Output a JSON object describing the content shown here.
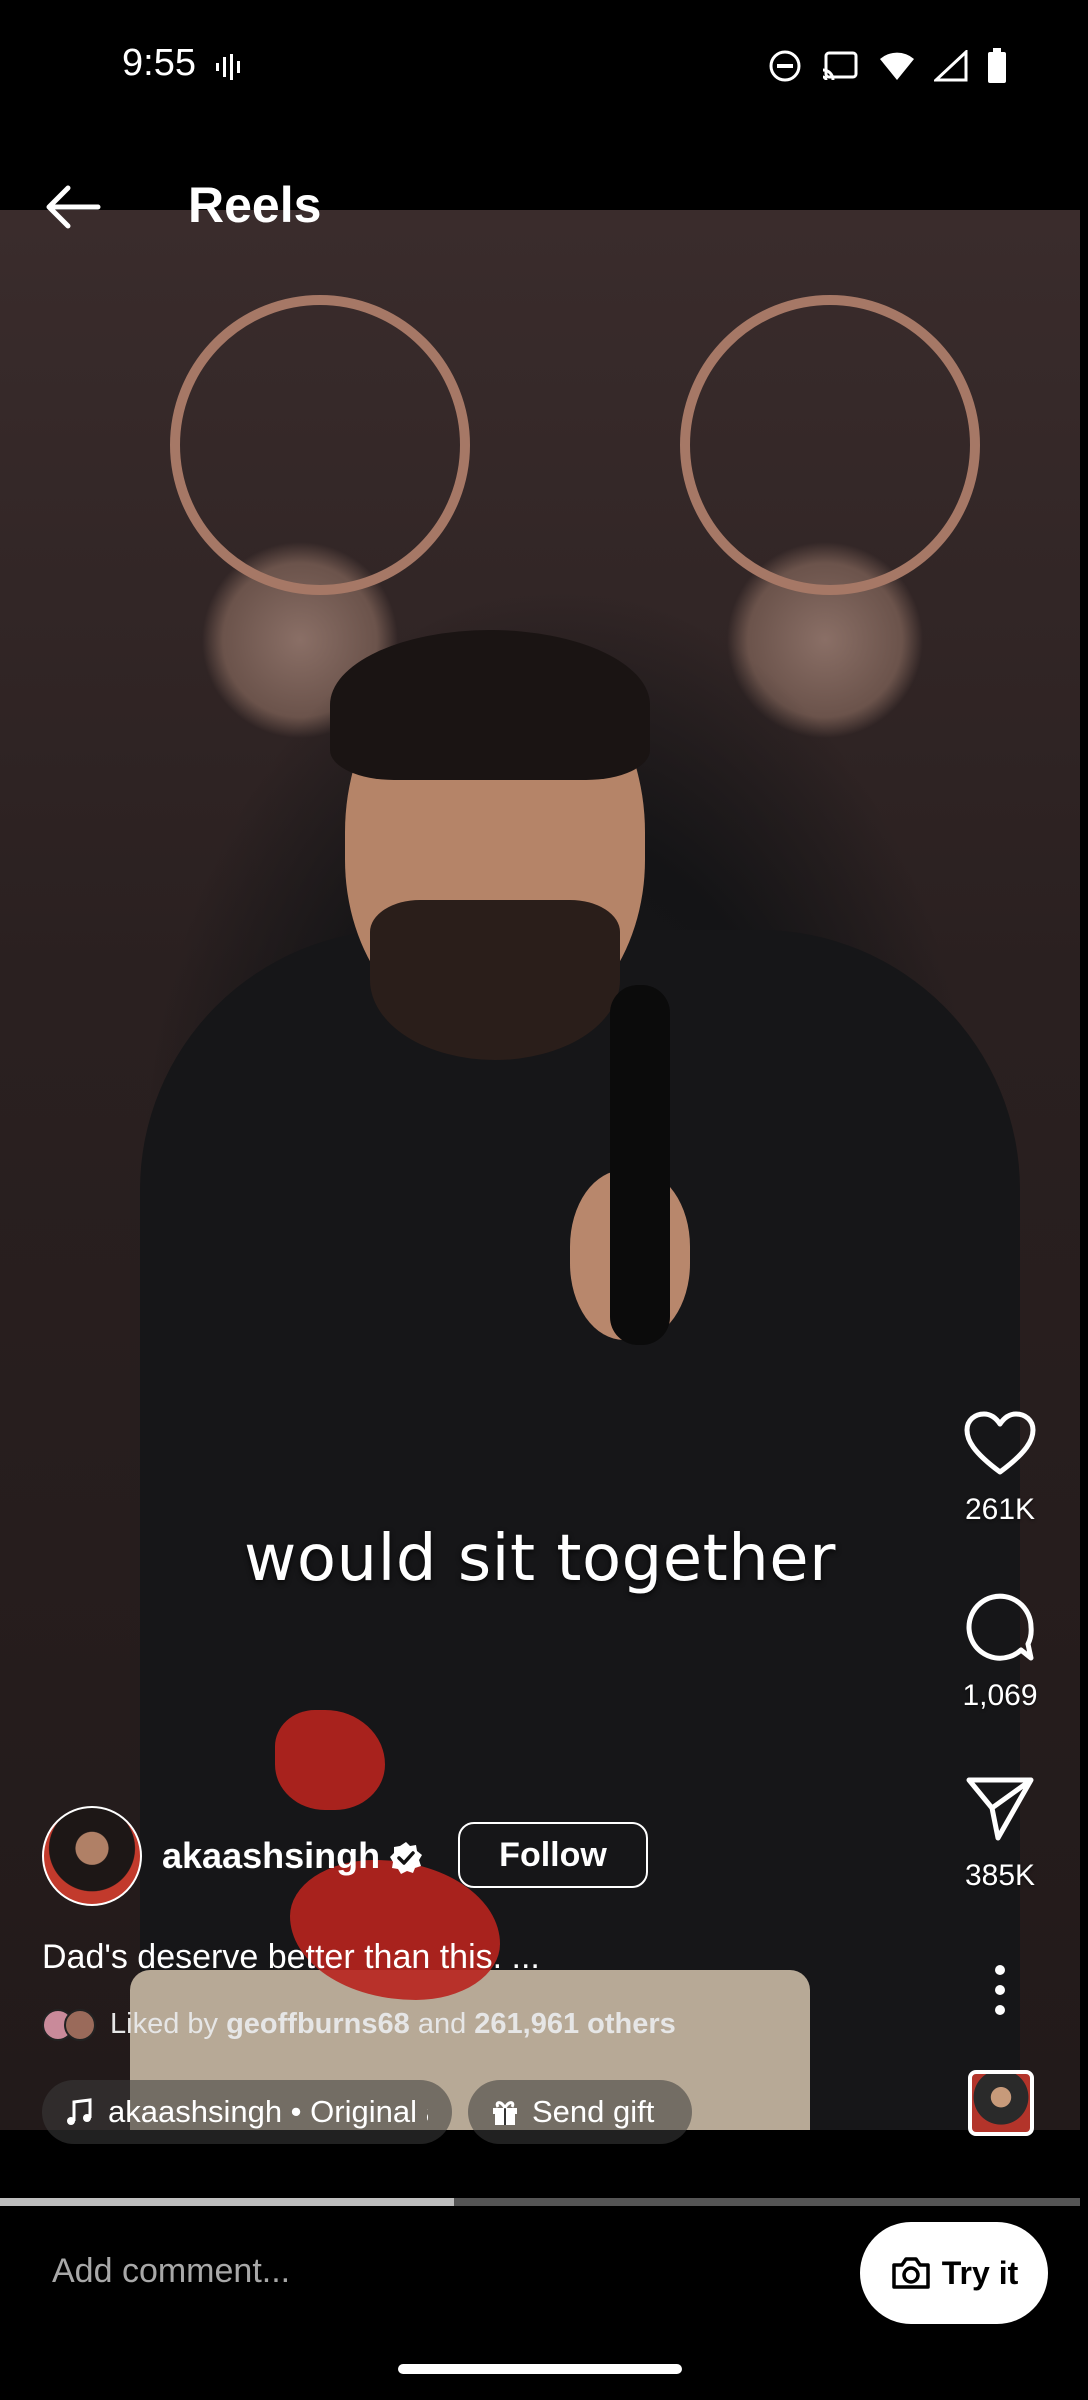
{
  "status_bar": {
    "time": "9:55"
  },
  "header": {
    "title": "Reels"
  },
  "video": {
    "caption": "would sit together"
  },
  "actions": {
    "likes": "261K",
    "comments": "1,069",
    "shares": "385K"
  },
  "author": {
    "username": "akaashsingh",
    "follow_label": "Follow"
  },
  "post": {
    "description": "Dad's deserve better than this. ...",
    "liked_by_prefix": "Liked by ",
    "liked_by_user": "geoffburns68",
    "liked_by_and": " and ",
    "liked_by_others": "261,961 others"
  },
  "chips": {
    "audio": "akaashsingh • Original audio",
    "gift": "Send gift"
  },
  "playback": {
    "progress": 0.42
  },
  "comment_bar": {
    "placeholder": "Add comment...",
    "try_it_label": "Try it"
  },
  "colors": {
    "accent": "#ffffff",
    "background": "#000000"
  },
  "icons": [
    "back-arrow-icon",
    "heart-icon",
    "comment-icon",
    "share-icon",
    "more-icon",
    "music-note-icon",
    "gift-icon",
    "camera-icon",
    "verified-icon"
  ]
}
